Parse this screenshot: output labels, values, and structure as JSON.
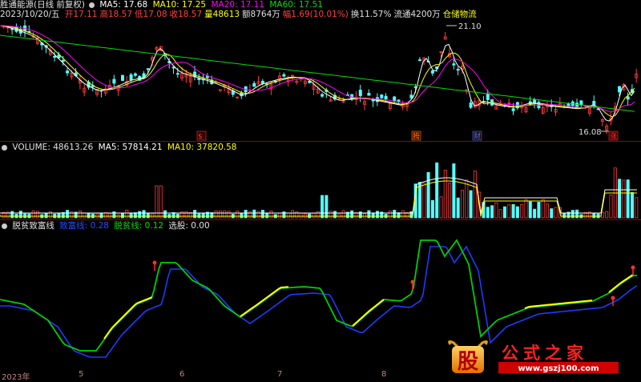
{
  "header": {
    "stock_name": "胜通能源(日线 前复权)",
    "ma5": "MA5: 17.68",
    "ma10": "MA10: 17.25",
    "ma20": "MA20: 17.11",
    "ma60": "MA60: 17.51",
    "date": "2023/10/20/五",
    "open": "开17.11",
    "high": "高18.57",
    "low": "低17.08",
    "close": "收18.57",
    "volume": "量48613",
    "amount": "额8764万",
    "change": "幅1.69(10.01%)",
    "turnover": "换11.57%",
    "float": "流通4200万",
    "sector": "仓储物流"
  },
  "price_panel": {
    "high_marker": "21.10",
    "low_marker": "16.08",
    "badges": [
      "$",
      "腾",
      "财",
      "涨"
    ]
  },
  "volume_panel": {
    "volume": "VOLUME: 48613.26",
    "ma5": "MA5: 57814.21",
    "ma10": "MA10: 37820.58"
  },
  "indicator_panel": {
    "name": "脱贫致富线",
    "line1": "致富线: 0.28",
    "line2": "脱贫线: 0.12",
    "select": "选股: 0.00"
  },
  "x_axis": {
    "labels": [
      "2023年",
      "5",
      "6",
      "7",
      "8"
    ]
  },
  "logo": {
    "char": "股",
    "text": "公式之家",
    "url": "www.gszj100.com"
  },
  "colors": {
    "up": "#ff3b3b",
    "down": "#54ffff",
    "ma5": "#ffffff",
    "ma10": "#ffff00",
    "ma20": "#ff00ff",
    "ma60": "#00e000",
    "blue": "#1a3cff",
    "green": "#00d000"
  }
}
